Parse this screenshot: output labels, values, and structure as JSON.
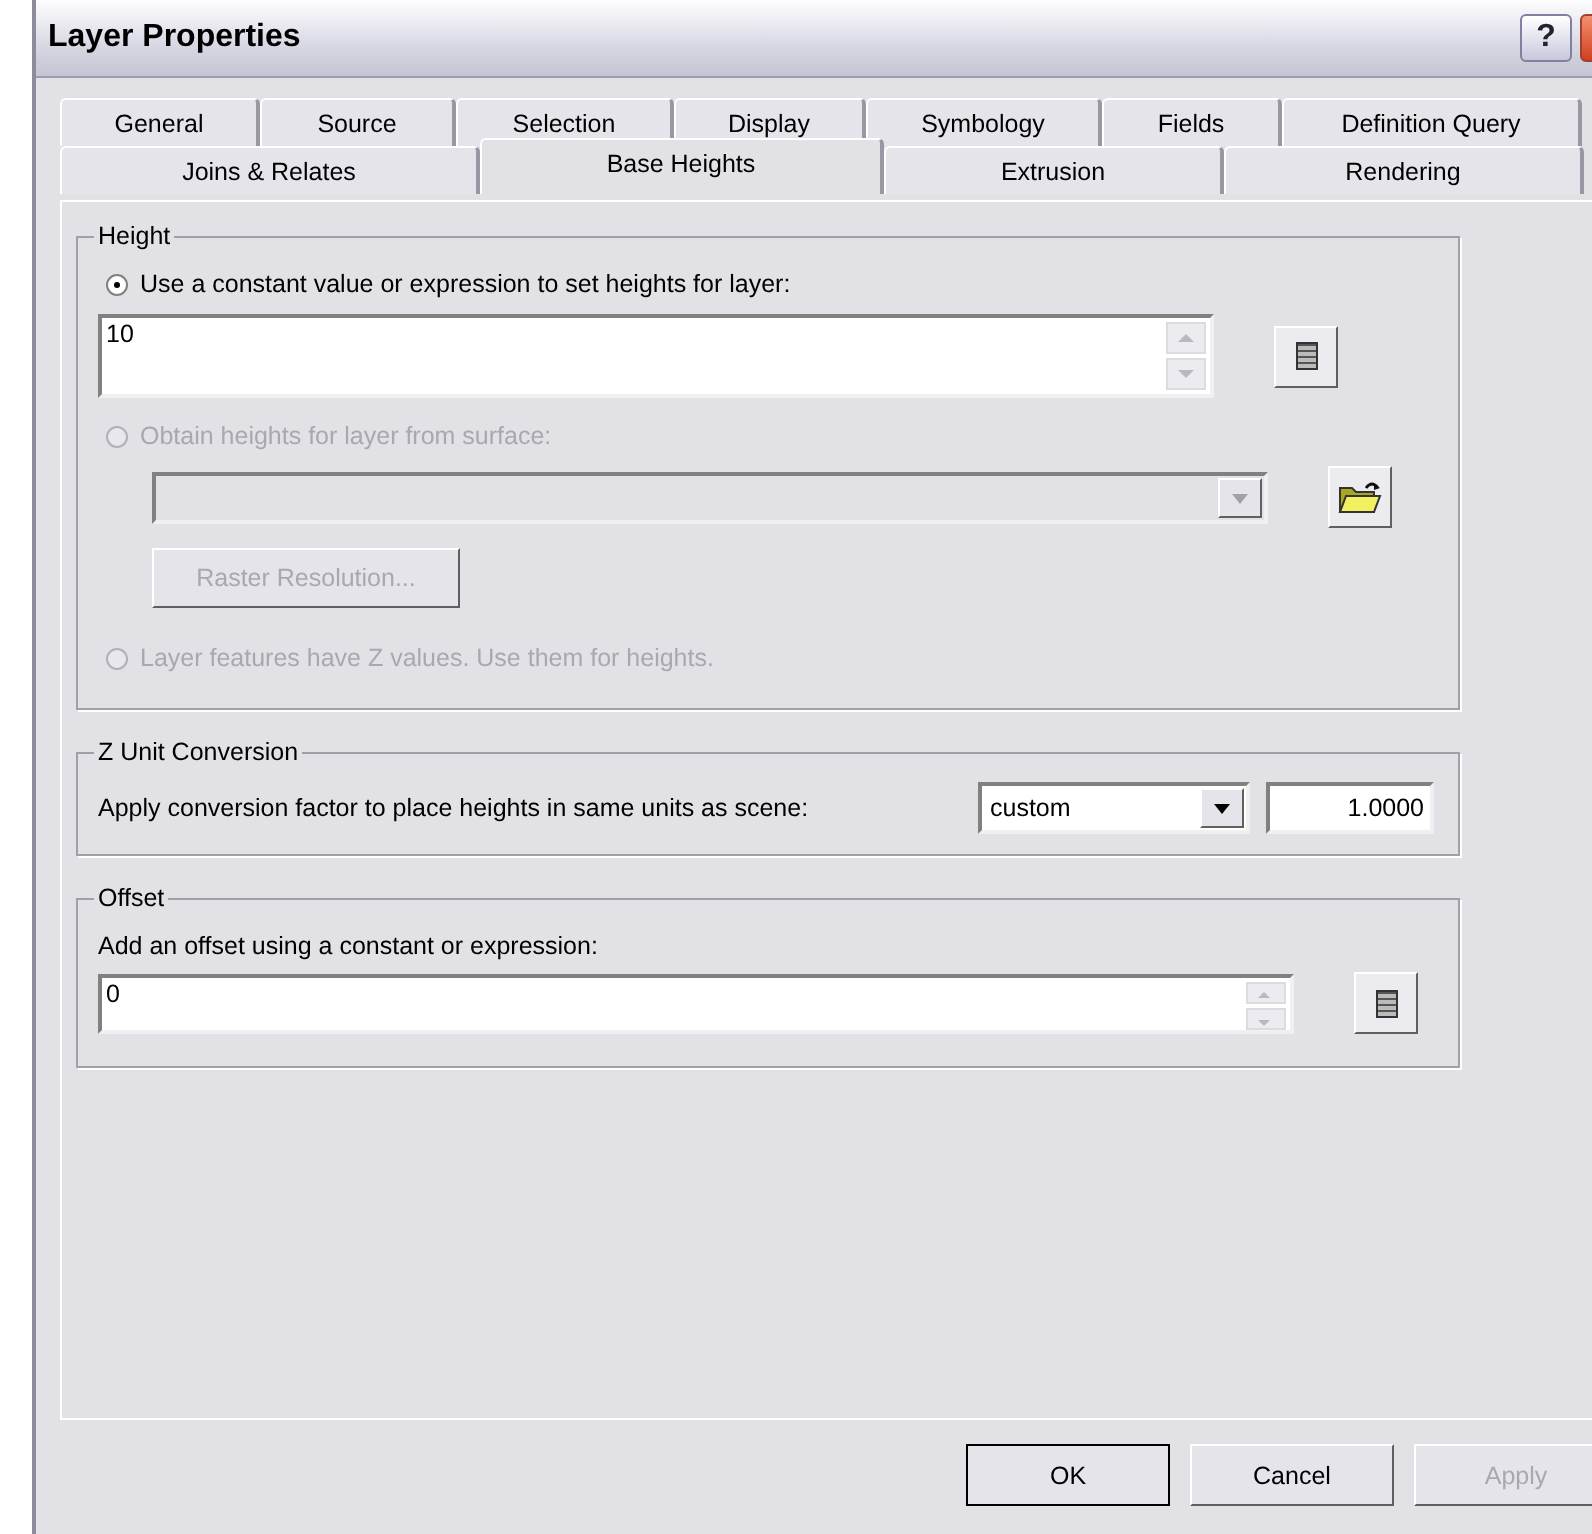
{
  "window": {
    "title": "Layer Properties",
    "help_glyph": "?"
  },
  "tab_rows": [
    {
      "tabs": [
        {
          "label": "General",
          "selected": false
        },
        {
          "label": "Source",
          "selected": false
        },
        {
          "label": "Selection",
          "selected": false
        },
        {
          "label": "Display",
          "selected": false
        },
        {
          "label": "Symbology",
          "selected": false
        },
        {
          "label": "Fields",
          "selected": false
        },
        {
          "label": "Definition Query",
          "selected": false
        }
      ]
    },
    {
      "tabs": [
        {
          "label": "Joins & Relates",
          "selected": false
        },
        {
          "label": "Base Heights",
          "selected": true
        },
        {
          "label": "Extrusion",
          "selected": false
        },
        {
          "label": "Rendering",
          "selected": false
        }
      ]
    }
  ],
  "height_group": {
    "title": "Height",
    "options": [
      {
        "kind": "expression",
        "label": "Use a constant value or expression to set heights for layer:",
        "selected": true,
        "disabled": false,
        "value": "10"
      },
      {
        "kind": "surface",
        "label": "Obtain heights for layer from surface:",
        "selected": false,
        "disabled": true,
        "button": "Raster Resolution..."
      },
      {
        "kind": "plain",
        "label": "Layer features have Z values.  Use them for heights.",
        "selected": false,
        "disabled": true
      }
    ]
  },
  "z_unit_group": {
    "title": "Z Unit Conversion",
    "label": "Apply conversion factor to place heights in same units as scene:",
    "unit": "custom",
    "factor": "1.0000"
  },
  "offset_group": {
    "title": "Offset",
    "label": "Add an offset using a constant or expression:",
    "value": "0"
  },
  "buttons": [
    {
      "label": "OK",
      "disabled": false,
      "default": true
    },
    {
      "label": "Cancel",
      "disabled": false,
      "default": false
    },
    {
      "label": "Apply",
      "disabled": true,
      "default": false
    }
  ]
}
